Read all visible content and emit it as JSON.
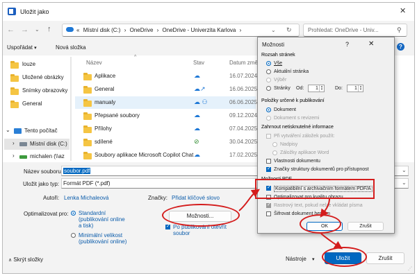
{
  "window": {
    "title": "Uložit jako"
  },
  "nav": {
    "path": [
      "«",
      "Místní disk (C:)",
      "OneDrive",
      "OneDrive - Univerzita Karlova"
    ],
    "search_placeholder": "Prohledat: OneDrive - Univ..."
  },
  "toolbar": {
    "organize": "Uspořádat",
    "new_folder": "Nová složka"
  },
  "sidebar": {
    "items": [
      {
        "label": "louze"
      },
      {
        "label": "Uložené obrázky"
      },
      {
        "label": "Snímky obrazovky"
      },
      {
        "label": "General"
      },
      {
        "label": "Tento počítač"
      },
      {
        "label": "Místní disk (C:)"
      },
      {
        "label": "michalen (\\\\az"
      }
    ]
  },
  "list": {
    "columns": {
      "name": "Název",
      "status": "Stav",
      "date": "Datum změny"
    },
    "rows": [
      {
        "name": "Aplikace",
        "date": "16.07.2024 12:"
      },
      {
        "name": "General",
        "date": "16.06.2025 12:"
      },
      {
        "name": "manualy",
        "date": "06.06.2025 12:"
      },
      {
        "name": "Přepsané soubory",
        "date": "09.12.2024 12:"
      },
      {
        "name": "Přílohy",
        "date": "07.04.2025 9:"
      },
      {
        "name": "sdílené",
        "date": "30.04.2025 12:"
      },
      {
        "name": "Soubory aplikace Microsoft Copilot Chat",
        "date": "17.02.2025 10:"
      }
    ]
  },
  "form": {
    "filename_label": "Název souboru:",
    "filename_value": "soubor.pdf",
    "type_label": "Uložit jako typ:",
    "type_value": "Formát PDF (*.pdf)",
    "authors_label": "Autoři:",
    "authors_value": "Lenka Michaleová",
    "tags_label": "Značky:",
    "tags_value": "Přidat klíčové slovo",
    "optimize_label": "Optimalizovat pro:",
    "opt_standard": "Standardní (publikování online a tisk)",
    "opt_minimal": "Minimální velikost (publikování online)",
    "options_button": "Možnosti...",
    "open_after": "Po publikování otevřít soubor",
    "hide_folders": "Skrýt složky",
    "tools": "Nástroje",
    "save": "Uložit",
    "cancel": "Zrušit"
  },
  "dialog": {
    "title": "Možnosti",
    "help": "?",
    "range_title": "Rozsah stránek",
    "all": "Vše",
    "current": "Aktuální stránka",
    "selection": "Výběr",
    "pages": "Stránky",
    "from": "Od:",
    "from_value": "1",
    "to": "Do:",
    "to_value": "1",
    "publish_title": "Položky určené k publikování",
    "document": "Dokument",
    "document_markup": "Dokument s revizemi",
    "nonprint_title": "Zahrnout netisknutelné informace",
    "bookmarks": "Při vytváření záložek použít:",
    "headings": "Nadpisy",
    "word_bookmarks": "Záložky aplikace Word",
    "properties": "Vlastnosti dokumentu",
    "structure_tags": "Značky struktury dokumentů pro přístupnost",
    "pdf_title": "Možnosti PDF",
    "pdfa": "Kompatibilní s archivačním formátem PDF/A",
    "optimize_image": "Optimalizovat pro kvalitu obrazu",
    "bitmap": "Rastrový text, pokud nelze vkládat písma",
    "encrypt": "Šifrovat dokument heslem",
    "ok": "OK",
    "cancel": "Zrušit"
  },
  "colors": {
    "accent": "#0067c0",
    "annotation": "#d41c1c",
    "folder": "#f5c543"
  }
}
